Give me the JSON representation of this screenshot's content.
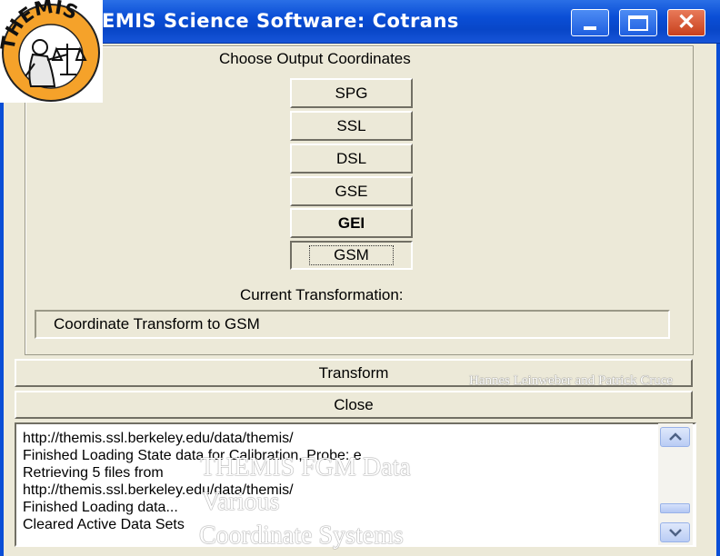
{
  "window": {
    "title": "EMIS Science Software: Cotrans",
    "controls": {
      "minimize_icon": "minimize-icon",
      "maximize_icon": "maximize-icon",
      "close_icon": "close-icon"
    },
    "brand_color": "#0a4ed6",
    "face_color": "#ece9d8"
  },
  "logo": {
    "text": "THEMIS",
    "ring_color": "#f5a22a"
  },
  "output_coordinates": {
    "label": "Choose Output Coordinates",
    "buttons": [
      "SPG",
      "SSL",
      "DSL",
      "GSE",
      "GEI",
      "GSM"
    ],
    "selected": "GSM"
  },
  "current_transformation": {
    "label": "Current Transformation:",
    "value": "Coordinate Transform to GSM"
  },
  "actions": {
    "transform": "Transform",
    "close": "Close"
  },
  "log": {
    "lines": [
      "http://themis.ssl.berkeley.edu/data/themis/",
      "Finished Loading State data for Calibration, Probe: e",
      "Retrieving 5 files from",
      "http://themis.ssl.berkeley.edu/data/themis/",
      "Finished Loading data...",
      "Cleared Active Data Sets"
    ]
  },
  "overlay": {
    "authors": "Hannes Leinweber and Patrick Cruce",
    "line1": "THEMIS FGM Data",
    "line2": "Various",
    "line3": "Coordinate Systems"
  }
}
